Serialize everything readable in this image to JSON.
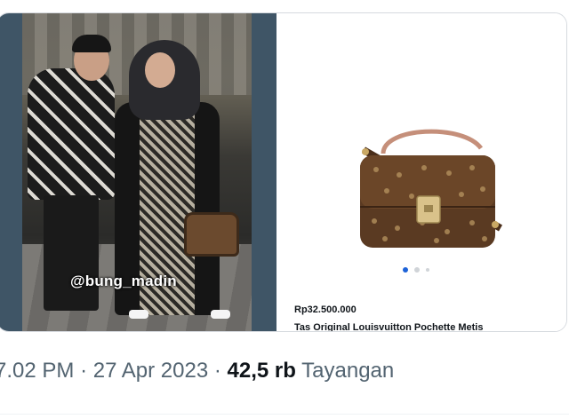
{
  "media": {
    "photo_watermark": "@bung_madin",
    "product": {
      "price": "Rp32.500.000",
      "title": "Tas Original Louisvuitton Pochette Metis",
      "carousel": {
        "count": 3,
        "active_index": 0
      }
    }
  },
  "tweet_meta": {
    "time": "7.02 PM",
    "separator": "·",
    "date": "27 Apr 2023",
    "views_count": "42,5 rb",
    "views_label": "Tayangan"
  },
  "colors": {
    "text_secondary": "#536471",
    "text_primary": "#0f1419",
    "carousel_active": "#1d63d8",
    "bag_brown": "#5a3a22"
  }
}
